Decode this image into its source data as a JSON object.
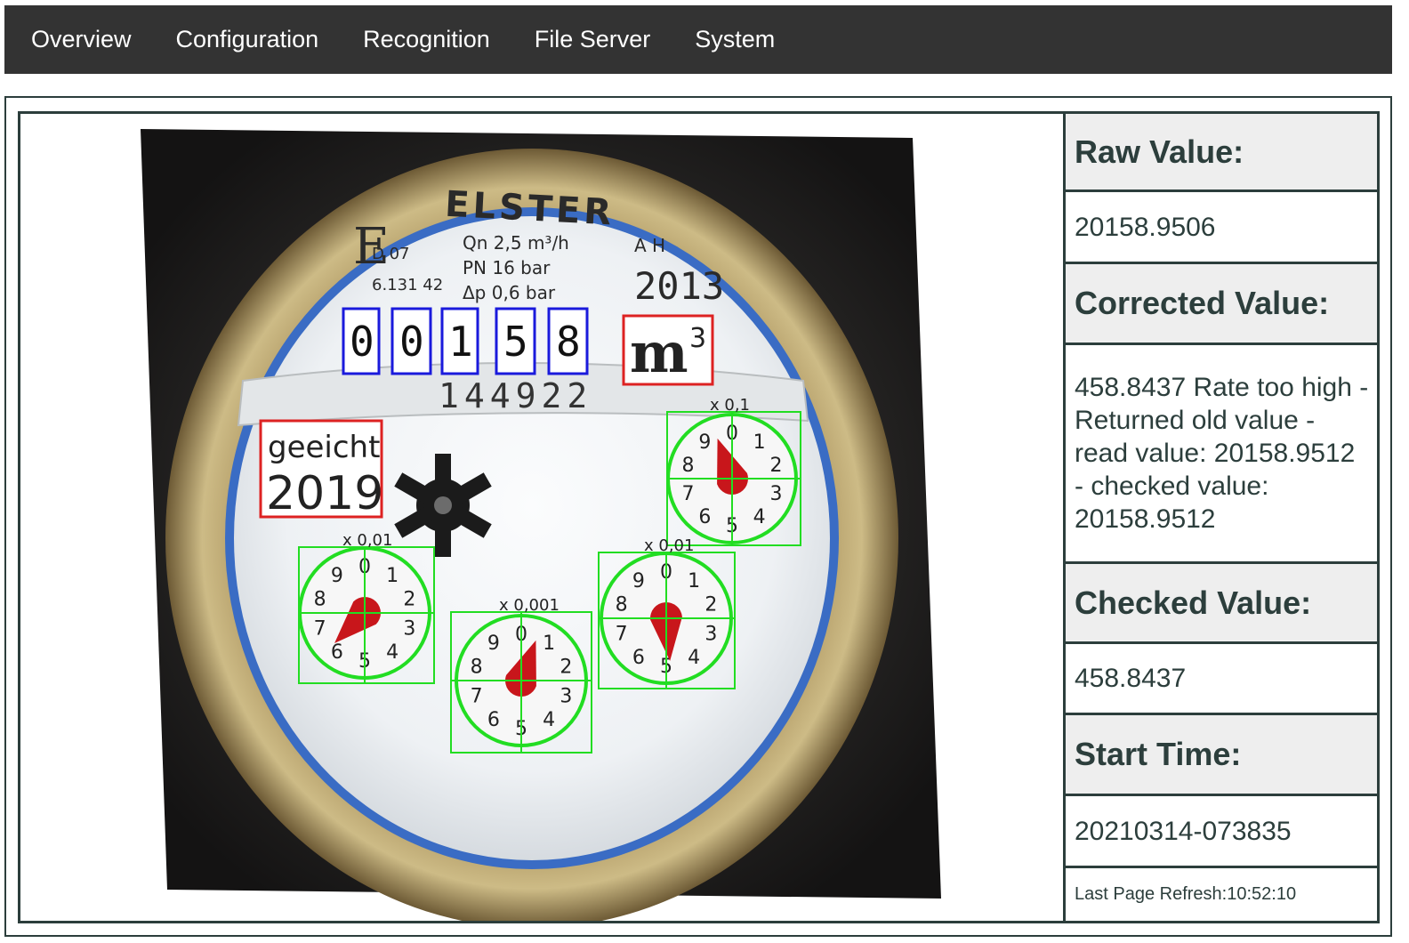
{
  "nav": {
    "items": [
      "Overview",
      "Configuration",
      "Recognition",
      "File Server",
      "System"
    ]
  },
  "meter": {
    "brand": "ELSTER",
    "specs": [
      "Qn 2,5 m³/h",
      "PN 16 bar",
      "Δp 0,6 bar"
    ],
    "cert": [
      "D 07",
      "6.131 42"
    ],
    "ah": "A H",
    "year": "2013",
    "digits": [
      "0",
      "0",
      "1",
      "5",
      "8"
    ],
    "unit": "m",
    "unit_exp": "3",
    "serial": "144922",
    "seal_word": "geeicht",
    "seal_year": "2019",
    "dial_labels": [
      "x 0,1",
      "x 0,01",
      "x 0,001",
      "x 0,01"
    ],
    "dial_numbers": [
      "0",
      "1",
      "2",
      "3",
      "4",
      "5",
      "6",
      "7",
      "8",
      "9"
    ]
  },
  "values": {
    "raw_label": "Raw Value:",
    "raw": "20158.9506",
    "corrected_label": "Corrected Value:",
    "corrected": "458.8437 Rate too high - Returned old value - read value: 20158.9512 - checked value: 20158.9512",
    "checked_label": "Checked Value:",
    "checked": "458.8437",
    "start_label": "Start Time:",
    "start": "20210314-073835",
    "refresh": "Last Page Refresh:10:52:10"
  },
  "colors": {
    "nav_bg": "#333333",
    "frame": "#2c3e3c",
    "digit_box": "#1a1adc",
    "roi_box": "#dd2222",
    "dial_box": "#22dd22",
    "pointer": "#c8161b"
  }
}
